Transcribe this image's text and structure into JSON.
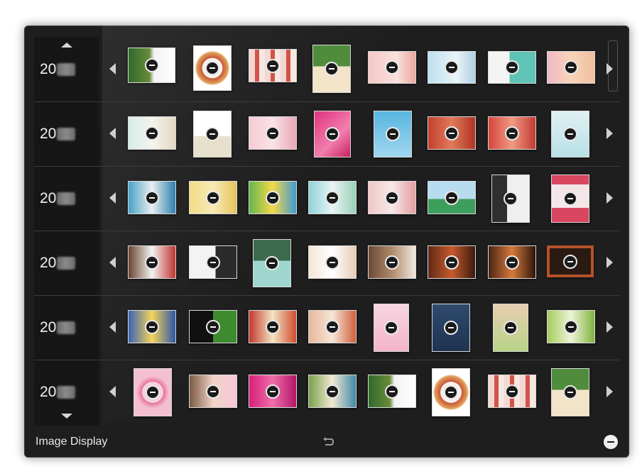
{
  "footer": {
    "label": "Image Display"
  },
  "rows": [
    {
      "year": "20",
      "thumbs": [
        "collage",
        "portrait",
        "collage",
        "calendar",
        "card",
        "card",
        "card",
        "card"
      ]
    },
    {
      "year": "20",
      "thumbs": [
        "card",
        "portrait",
        "card",
        "pink",
        "blue",
        "card",
        "card",
        "calendar"
      ]
    },
    {
      "year": "20",
      "thumbs": [
        "card",
        "card",
        "card",
        "card",
        "card",
        "card",
        "portrait",
        "portrait"
      ]
    },
    {
      "year": "20",
      "thumbs": [
        "card",
        "card",
        "calendar",
        "card",
        "card",
        "card",
        "card",
        "framed"
      ]
    },
    {
      "year": "20",
      "thumbs": [
        "card",
        "dark",
        "card",
        "card",
        "portrait",
        "navy",
        "portrait",
        "card"
      ]
    },
    {
      "year": "20",
      "thumbs": [
        "pink",
        "card",
        "magenta",
        "card",
        "card",
        "portrait",
        "card",
        "calendar"
      ]
    }
  ],
  "colors": {
    "panel": "#1e1e1e",
    "year_column": "#161616",
    "text": "#f0f0f0",
    "badge": "#1a1a1a"
  },
  "icons": {
    "scroll_up": "triangle-up-icon",
    "scroll_down": "triangle-down-icon",
    "row_prev": "triangle-left-icon",
    "row_next": "triangle-right-icon",
    "thumb_badge": "minus-circle-icon",
    "return": "return-arrow-icon",
    "hide": "minus-circle-icon"
  }
}
